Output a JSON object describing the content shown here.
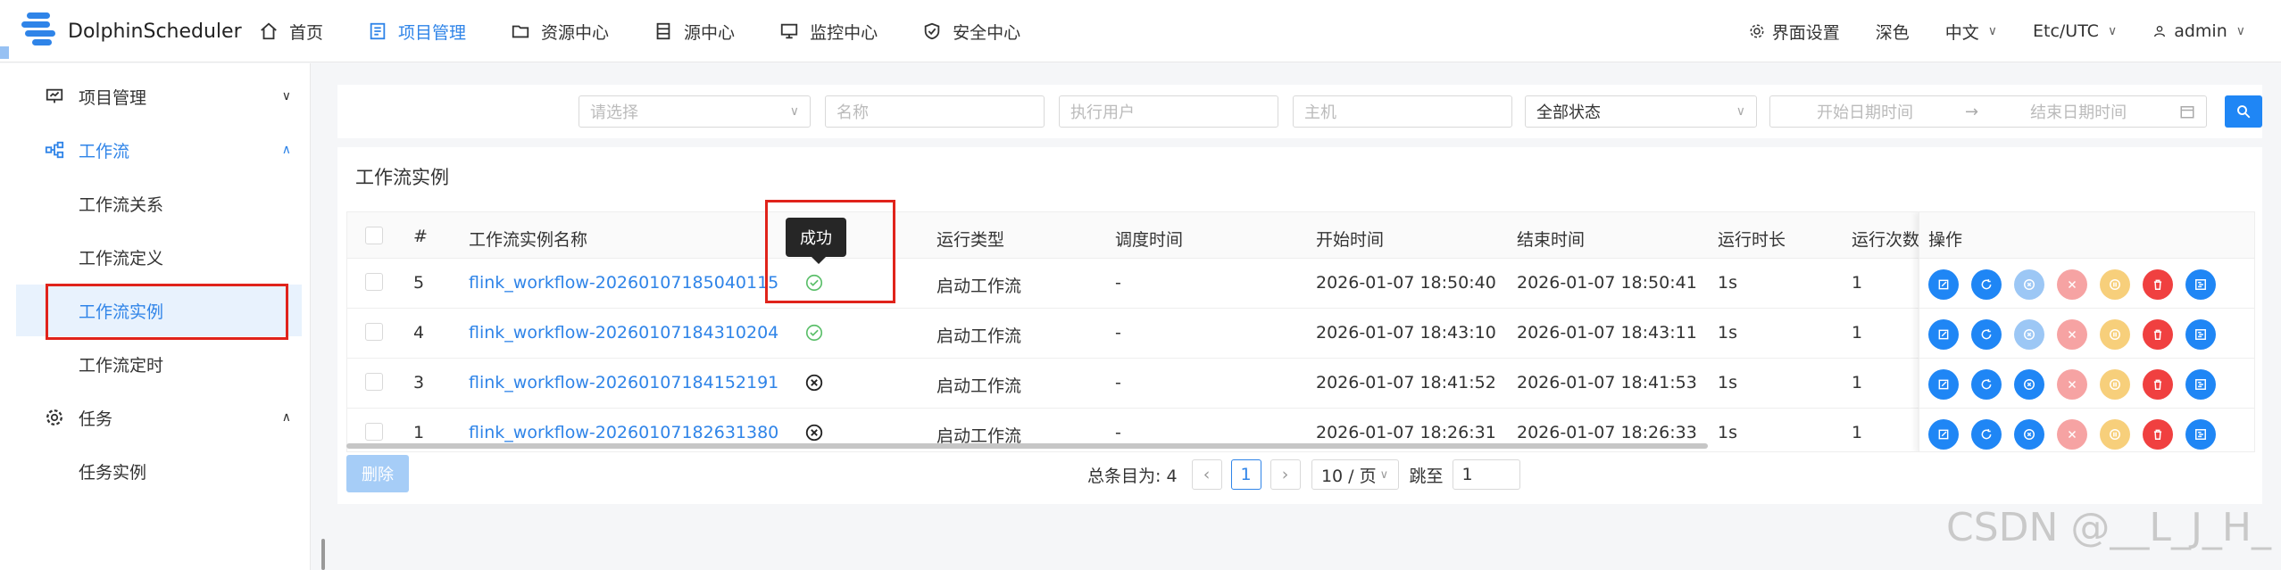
{
  "header": {
    "app_title": "DolphinScheduler",
    "nav": [
      {
        "label": "首页",
        "icon": "home-icon"
      },
      {
        "label": "项目管理",
        "icon": "project-icon"
      },
      {
        "label": "资源中心",
        "icon": "folder-icon"
      },
      {
        "label": "源中心",
        "icon": "datasource-icon"
      },
      {
        "label": "监控中心",
        "icon": "monitor-icon"
      },
      {
        "label": "安全中心",
        "icon": "shield-icon"
      }
    ],
    "settings_label": "界面设置",
    "theme_label": "深色",
    "language_label": "中文",
    "timezone_label": "Etc/UTC",
    "user_label": "admin"
  },
  "sidebar": {
    "project_mgmt": "项目管理",
    "workflow": "工作流",
    "workflow_relation": "工作流关系",
    "workflow_definition": "工作流定义",
    "workflow_instance": "工作流实例",
    "workflow_timing": "工作流定时",
    "task": "任务",
    "task_instance": "任务实例"
  },
  "filters": {
    "project_placeholder": "请选择",
    "name_placeholder": "名称",
    "executor_placeholder": "执行用户",
    "host_placeholder": "主机",
    "status_value": "全部状态",
    "start_date_placeholder": "开始日期时间",
    "end_date_placeholder": "结束日期时间"
  },
  "panel": {
    "title": "工作流实例",
    "columns": {
      "index": "#",
      "name": "工作流实例名称",
      "run_type": "运行类型",
      "schedule_time": "调度时间",
      "start_time": "开始时间",
      "end_time": "结束时间",
      "duration": "运行时长",
      "run_times": "运行次数",
      "ops": "操作"
    },
    "rows": [
      {
        "id": "5",
        "name": "flink_workflow-20260107185040115",
        "status": "success",
        "run_type": "启动工作流",
        "schedule_time": "-",
        "start_time": "2026-01-07 18:50:40",
        "end_time": "2026-01-07 18:50:41",
        "duration": "1s",
        "run_times": "1"
      },
      {
        "id": "4",
        "name": "flink_workflow-20260107184310204",
        "status": "success",
        "run_type": "启动工作流",
        "schedule_time": "-",
        "start_time": "2026-01-07 18:43:10",
        "end_time": "2026-01-07 18:43:11",
        "duration": "1s",
        "run_times": "1"
      },
      {
        "id": "3",
        "name": "flink_workflow-20260107184152191",
        "status": "failed",
        "run_type": "启动工作流",
        "schedule_time": "-",
        "start_time": "2026-01-07 18:41:52",
        "end_time": "2026-01-07 18:41:53",
        "duration": "1s",
        "run_times": "1"
      },
      {
        "id": "1",
        "name": "flink_workflow-20260107182631380",
        "status": "failed",
        "run_type": "启动工作流",
        "schedule_time": "-",
        "start_time": "2026-01-07 18:26:31",
        "end_time": "2026-01-07 18:26:33",
        "duration": "1s",
        "run_times": "1"
      }
    ],
    "tooltip": "成功"
  },
  "footer": {
    "delete_label": "删除",
    "total_label": "总条目为: 4",
    "current_page": "1",
    "page_size_label": "10 / 页",
    "goto_label": "跳至",
    "goto_value": "1"
  },
  "watermark": "CSDN @__L_J_H_",
  "colors": {
    "primary": "#1f86f5",
    "edit": "#1f86f5",
    "rerun": "#1f86f5",
    "stop": "#1f86f5",
    "stop_disabled": "#9cc7f5",
    "kill": "#f6a3a3",
    "pause": "#f7cf7b",
    "delete": "#f04040",
    "gantt": "#1f86f5",
    "success": "#5bbf6a",
    "failed": "#222222",
    "highlight_box": "#e0231b"
  }
}
